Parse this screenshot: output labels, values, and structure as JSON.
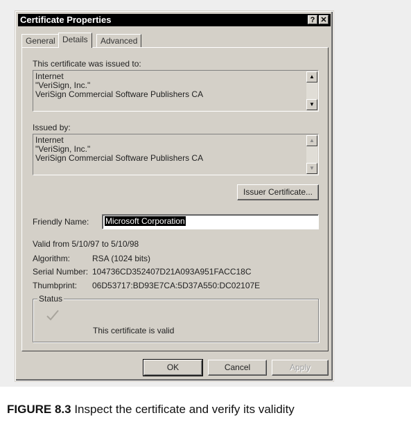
{
  "window": {
    "title": "Certificate Properties",
    "help_glyph": "?",
    "close_glyph": "✕"
  },
  "tabs": [
    {
      "label": "General",
      "active": false
    },
    {
      "label": "Details",
      "active": true
    },
    {
      "label": "Advanced",
      "active": false
    }
  ],
  "issued_to": {
    "label": "This certificate was issued to:",
    "lines": [
      "Internet",
      "\"VeriSign, Inc.\"",
      "VeriSign Commercial Software Publishers CA"
    ]
  },
  "issued_by": {
    "label": "Issued by:",
    "lines": [
      "Internet",
      "\"VeriSign, Inc.\"",
      "VeriSign Commercial Software Publishers CA"
    ]
  },
  "issuer_certificate_button": "Issuer Certificate...",
  "friendly_name": {
    "label": "Friendly Name:",
    "value": "Microsoft Corporation"
  },
  "validity": "Valid from 5/10/97 to 5/10/98",
  "details": {
    "algorithm_label": "Algorithm:",
    "algorithm_value": "RSA (1024 bits)",
    "serial_label": "Serial Number:",
    "serial_value": "104736CD352407D21A093A951FACC18C",
    "thumbprint_label": "Thumbprint:",
    "thumbprint_value": "06D53717:BD93E7CA:5D37A550:DC02107E"
  },
  "status": {
    "title": "Status",
    "icon": "checkmark-icon",
    "message": "This certificate is valid"
  },
  "buttons": {
    "ok": "OK",
    "cancel": "Cancel",
    "apply": "Apply"
  },
  "caption": {
    "figure_label": "FIGURE 8.3",
    "text": "Inspect the certificate and verify its validity"
  },
  "colors": {
    "face": "#d4d0c8",
    "titlebar": "#000000",
    "selection": "#000000"
  }
}
